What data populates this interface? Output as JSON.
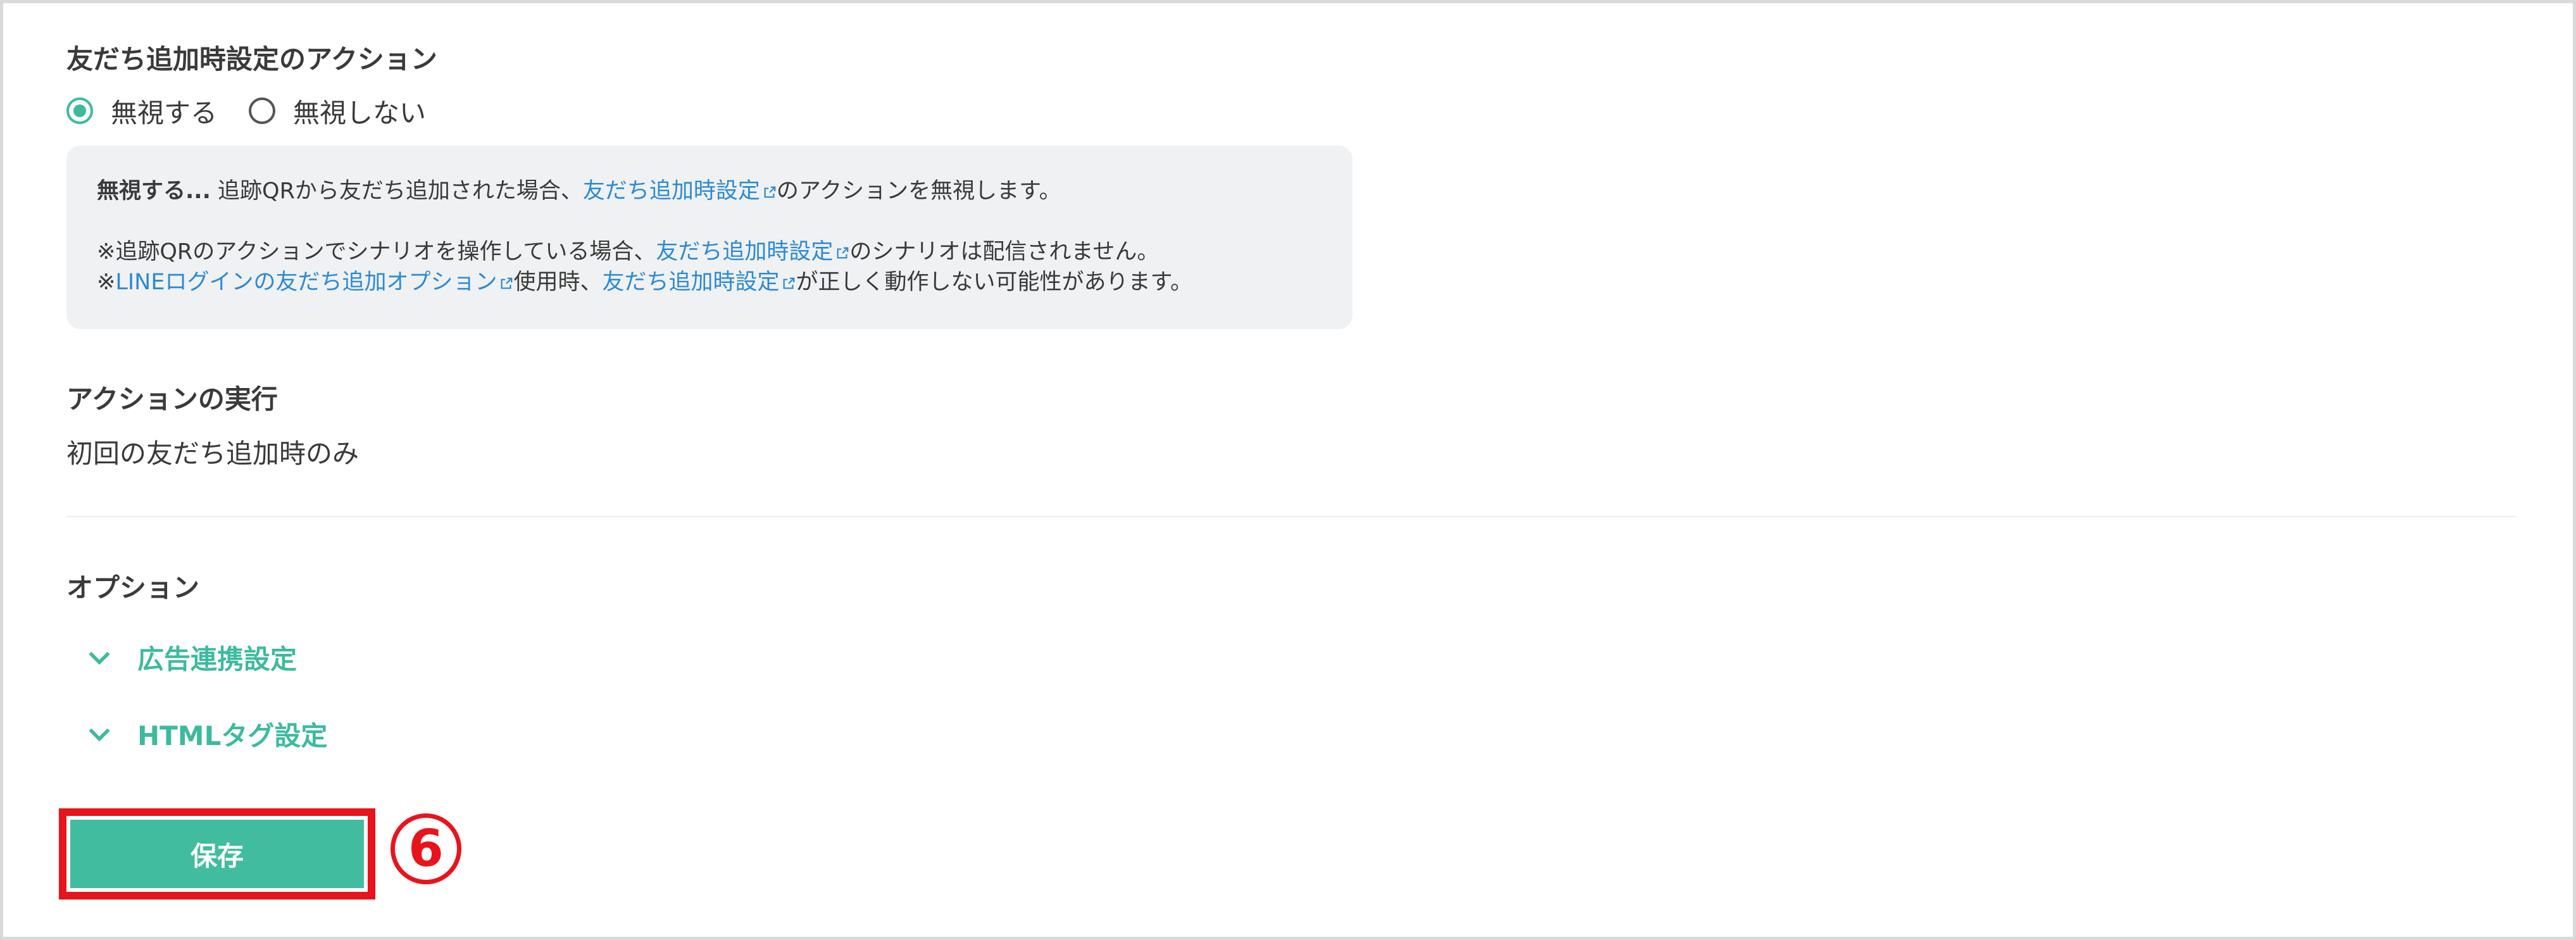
{
  "friend_action": {
    "heading": "友だち追加時設定のアクション",
    "options": [
      {
        "label": "無視する",
        "selected": true
      },
      {
        "label": "無視しない",
        "selected": false
      }
    ]
  },
  "info": {
    "line1_bold": "無視する...",
    "line1_a": " 追跡QRから友だち追加された場合、",
    "line1_link": "友だち追加時設定",
    "line1_b": "のアクションを無視します。",
    "line2_a": "※追跡QRのアクションでシナリオを操作している場合、",
    "line2_link": "友だち追加時設定",
    "line2_b": "のシナリオは配信されません。",
    "line3_a": "※",
    "line3_link1": "LINEログインの友だち追加オプション",
    "line3_b": "使用時、",
    "line3_link2": "友だち追加時設定",
    "line3_c": "が正しく動作しない可能性があります。"
  },
  "execution": {
    "heading": "アクションの実行",
    "value": "初回の友だち追加時のみ"
  },
  "options_section": {
    "heading": "オプション",
    "items": [
      {
        "label": "広告連携設定"
      },
      {
        "label": "HTMLタグ設定"
      }
    ]
  },
  "save_button": {
    "label": "保存"
  },
  "annotation": {
    "marker": "6"
  },
  "colors": {
    "accent": "#3dba9e",
    "link": "#2b8ad6",
    "highlight": "#e8141c"
  }
}
